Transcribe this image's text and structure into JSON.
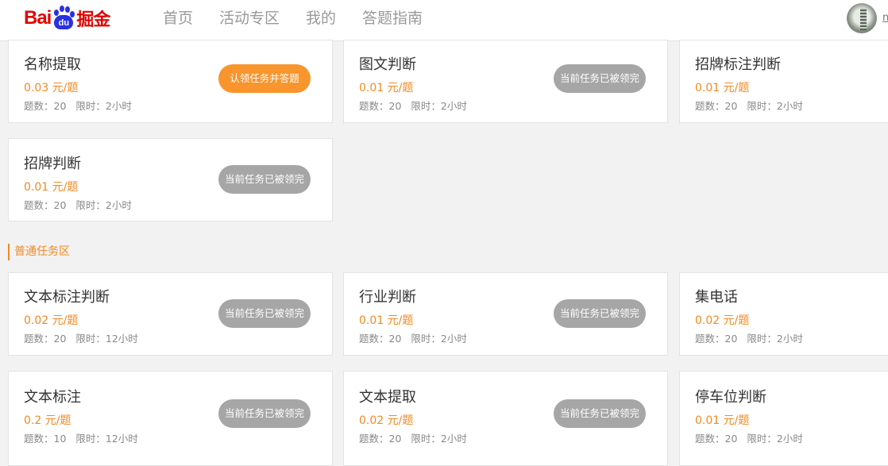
{
  "header": {
    "logo": {
      "text_red": "Bai",
      "text_paw": "du",
      "text_suffix": "掘金"
    },
    "nav": [
      "首页",
      "活动专区",
      "我的",
      "答题指南"
    ],
    "username_initial": "n"
  },
  "colors": {
    "accent": "#f08a24",
    "button_active": "#f8952c",
    "button_disabled": "#a6a6a6",
    "logo_red": "#e10602",
    "logo_blue": "#2932e1"
  },
  "section_normal": {
    "title": "普通任务区"
  },
  "tasks": [
    {
      "title": "名称提取",
      "price": "0.03 元/题",
      "count": "题数：20",
      "time": "限时：2小时",
      "button": "认领任务并答题",
      "active": true
    },
    {
      "title": "图文判断",
      "price": "0.01 元/题",
      "count": "题数：20",
      "time": "限时：2小时",
      "button": "当前任务已被领完",
      "active": false
    },
    {
      "title": "招牌标注判断",
      "price": "0.01 元/题",
      "count": "题数：20",
      "time": "限时：2小时",
      "button": "",
      "active": false
    },
    {
      "title": "招牌判断",
      "price": "0.01 元/题",
      "count": "题数：20",
      "time": "限时：2小时",
      "button": "当前任务已被领完",
      "active": false
    },
    {
      "title": "文本标注判断",
      "price": "0.02 元/题",
      "count": "题数：20",
      "time": "限时：12小时",
      "button": "当前任务已被领完",
      "active": false
    },
    {
      "title": "行业判断",
      "price": "0.01 元/题",
      "count": "题数：20",
      "time": "限时：2小时",
      "button": "当前任务已被领完",
      "active": false
    },
    {
      "title": "集电话",
      "price": "0.02 元/题",
      "count": "题数：20",
      "time": "限时：2小时",
      "button": "",
      "active": false
    },
    {
      "title": "文本标注",
      "price": "0.2 元/题",
      "count": "题数：10",
      "time": "限时：12小时",
      "button": "当前任务已被领完",
      "active": false
    },
    {
      "title": "文本提取",
      "price": "0.02 元/题",
      "count": "题数：20",
      "time": "限时：2小时",
      "button": "当前任务已被领完",
      "active": false
    },
    {
      "title": "停车位判断",
      "price": "0.01 元/题",
      "count": "题数：20",
      "time": "限时：2小时",
      "button": "",
      "active": false
    }
  ]
}
